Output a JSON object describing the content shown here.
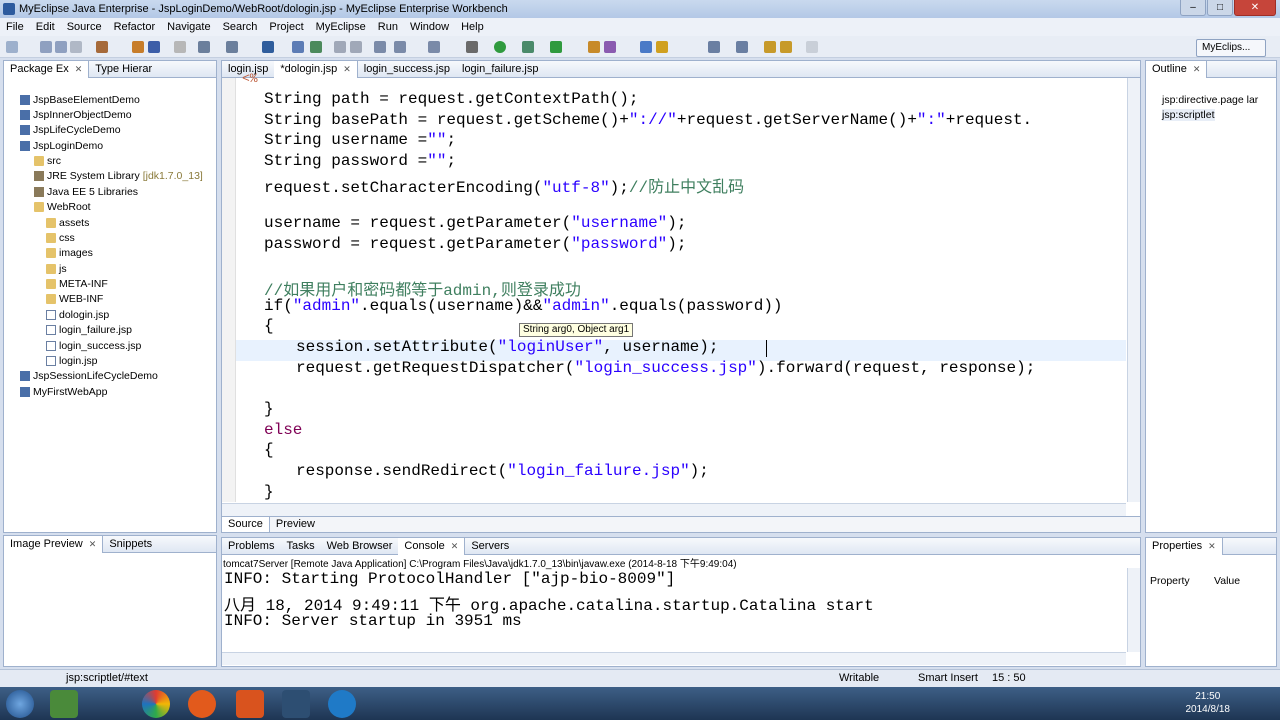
{
  "window": {
    "title": "MyEclipse Java Enterprise - JspLoginDemo/WebRoot/dologin.jsp - MyEclipse Enterprise Workbench"
  },
  "menu": [
    "File",
    "Edit",
    "Source",
    "Refactor",
    "Navigate",
    "Search",
    "Project",
    "MyEclipse",
    "Run",
    "Window",
    "Help"
  ],
  "perspective": "MyEclips...",
  "left_panel": {
    "tabs": [
      "Package Ex",
      "Type Hierar"
    ],
    "tree": [
      "JspBaseElementDemo",
      "JspInnerObjectDemo",
      "JspLifeCycleDemo",
      "JspLoginDemo",
      "src",
      "JRE System Library",
      "[jdk1.7.0_13]",
      "Java EE 5 Libraries",
      "WebRoot",
      "assets",
      "css",
      "images",
      "js",
      "META-INF",
      "WEB-INF",
      "dologin.jsp",
      "login_failure.jsp",
      "login_success.jsp",
      "login.jsp",
      "JspSessionLifeCycleDemo",
      "MyFirstWebApp"
    ]
  },
  "editor": {
    "tabs": [
      "login.jsp",
      "*dologin.jsp",
      "login_success.jsp",
      "login_failure.jsp"
    ],
    "bottom_tabs": [
      "Source",
      "Preview"
    ],
    "tooltip": "String arg0, Object arg1",
    "top_glyph": "<%"
  },
  "outline": {
    "tab": "Outline",
    "items": [
      "jsp:directive.page lar",
      "jsp:scriptlet"
    ]
  },
  "image_preview": {
    "tabs": [
      "Image Preview",
      "Snippets"
    ]
  },
  "console": {
    "tabs": [
      "Problems",
      "Tasks",
      "Web Browser",
      "Console",
      "Servers"
    ],
    "header": "tomcat7Server [Remote Java Application] C:\\Program Files\\Java\\jdk1.7.0_13\\bin\\javaw.exe (2014-8-18 下午9:49:04)",
    "lines": [
      "INFO: Starting ProtocolHandler [\"ajp-bio-8009\"]",
      "八月 18, 2014 9:49:11 下午 org.apache.catalina.startup.Catalina start",
      "INFO: Server startup in 3951 ms"
    ]
  },
  "properties": {
    "tab": "Properties",
    "col1": "Property",
    "col2": "Value"
  },
  "status": {
    "context": "jsp:scriptlet/#text",
    "mode": "Writable",
    "insert": "Smart Insert",
    "pos": "15 : 50"
  },
  "taskbar": {
    "time": "21:50",
    "date": "2014/8/18"
  }
}
